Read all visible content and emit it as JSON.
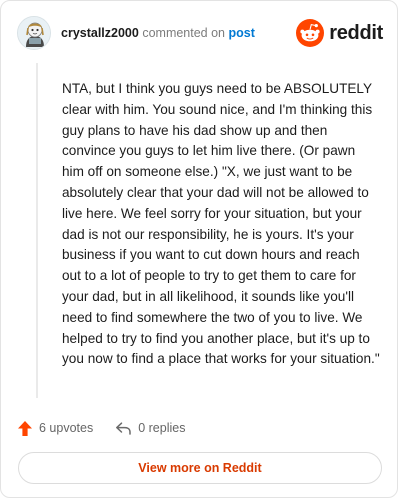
{
  "header": {
    "username": "crystallz2000",
    "action_text": "commented on",
    "post_link": "post",
    "brand": "reddit"
  },
  "comment": {
    "text": "NTA, but I think you guys need to be ABSOLUTELY clear with him. You sound nice, and I'm thinking this guy plans to have his dad show up and then convince you guys to let him live there. (Or pawn him off on someone else.) \"X, we just want to be absolutely clear that your dad will not be allowed to live here. We feel sorry for your situation, but your dad is not our responsibility, he is yours. It's your business if you want to cut down hours and reach out to a lot of people to try to get them to care for your dad, but in all likelihood, it sounds like you'll need to find somewhere the two of you to live. We helped to try to find you another place, but it's up to you now to find a place that works for your situation.\""
  },
  "actions": {
    "upvotes": "6 upvotes",
    "replies": "0 replies"
  },
  "footer": {
    "view_more": "View more on Reddit"
  },
  "colors": {
    "brand_orange": "#ff4500",
    "link_blue": "#0079d3",
    "view_more_text": "#d93a00",
    "upvote_arrow": "#ff4500"
  },
  "icons": {
    "avatar": "avatar",
    "logo": "reddit-snoo-icon",
    "upvote": "upvote-arrow-icon",
    "reply": "reply-arrow-icon"
  }
}
